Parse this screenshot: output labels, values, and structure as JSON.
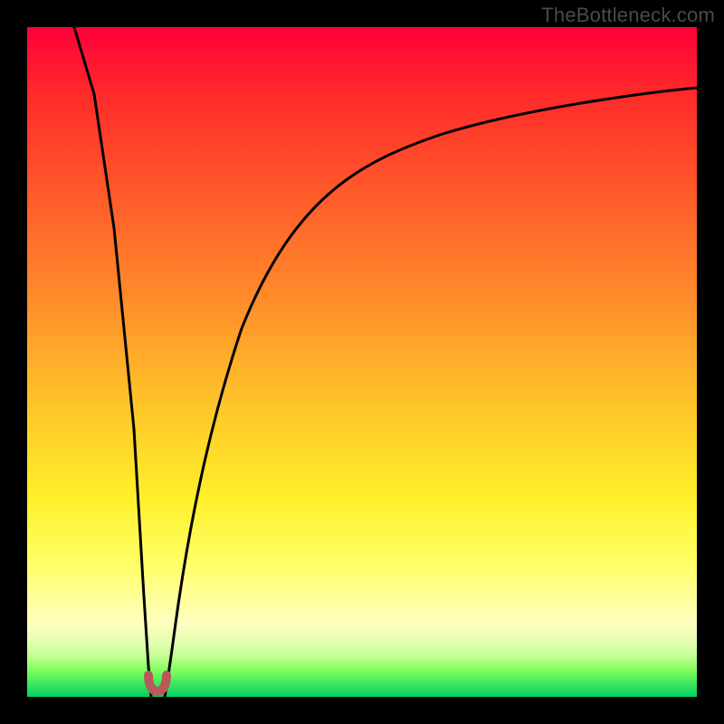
{
  "watermark": "TheBottleneck.com",
  "chart_data": {
    "type": "line",
    "title": "",
    "xlabel": "",
    "ylabel": "",
    "xlim": [
      0,
      100
    ],
    "ylim": [
      0,
      100
    ],
    "grid": false,
    "legend": false,
    "series": [
      {
        "name": "left-branch",
        "x": [
          7,
          10,
          13,
          16,
          17.5,
          18,
          18.5
        ],
        "y": [
          100,
          75,
          50,
          25,
          8,
          3,
          0
        ]
      },
      {
        "name": "right-branch",
        "x": [
          20.5,
          21,
          22,
          24,
          27,
          32,
          40,
          50,
          62,
          78,
          100
        ],
        "y": [
          0,
          3,
          10,
          25,
          40,
          55,
          70,
          78,
          84,
          88,
          91
        ]
      }
    ],
    "marker": {
      "name": "bottleneck-point",
      "x_range": [
        18,
        21
      ],
      "y": 2,
      "shape": "u"
    },
    "background_gradient": {
      "orientation": "vertical",
      "stops": [
        {
          "pos": 0.0,
          "color": "#ff003a"
        },
        {
          "pos": 0.55,
          "color": "#ffc02a"
        },
        {
          "pos": 0.8,
          "color": "#ffff66"
        },
        {
          "pos": 1.0,
          "color": "#00d060"
        }
      ]
    }
  }
}
